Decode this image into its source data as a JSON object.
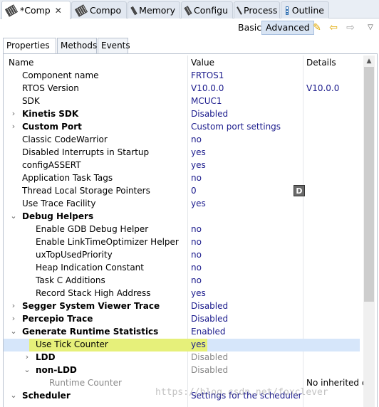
{
  "tabs": [
    {
      "label": "*Comp",
      "icon": "chip-icon",
      "active": true,
      "closable": true
    },
    {
      "label": "Compo",
      "icon": "chip-icon"
    },
    {
      "label": "Memory",
      "icon": "chip-icon"
    },
    {
      "label": "Configu",
      "icon": "chip-icon"
    },
    {
      "label": "Process",
      "icon": "chip-icon"
    },
    {
      "label": "Outline",
      "icon": "outline-icon"
    }
  ],
  "toolbar": {
    "basic_label": "Basic",
    "advanced_label": "Advanced",
    "selected_mode": "Advanced"
  },
  "subtabs": [
    "Properties",
    "Methods",
    "Events"
  ],
  "grid": {
    "headers": {
      "name": "Name",
      "value": "Value",
      "details": "Details"
    },
    "rows": [
      {
        "name": "Component name",
        "value": "FRTOS1",
        "details": ""
      },
      {
        "name": "RTOS Version",
        "value": "V10.0.0",
        "details": "V10.0.0"
      },
      {
        "name": "SDK",
        "value": "MCUC1",
        "details": ""
      },
      {
        "name": "Kinetis SDK",
        "value": "Disabled",
        "details": ""
      },
      {
        "name": "Custom Port",
        "value": "Custom port settings",
        "details": ""
      },
      {
        "name": "Classic CodeWarrior",
        "value": "no",
        "details": ""
      },
      {
        "name": "Disabled Interrupts in Startup",
        "value": "yes",
        "details": ""
      },
      {
        "name": "configASSERT",
        "value": "yes",
        "details": ""
      },
      {
        "name": "Application Task Tags",
        "value": "no",
        "details": ""
      },
      {
        "name": "Thread Local Storage Pointers",
        "value": "0",
        "details": "",
        "button": "D"
      },
      {
        "name": "Use Trace Facility",
        "value": "yes",
        "details": ""
      },
      {
        "name": "Debug Helpers",
        "value": "",
        "details": ""
      },
      {
        "name": "Enable GDB Debug Helper",
        "value": "no",
        "details": ""
      },
      {
        "name": "Enable LinkTimeOptimizer Helper",
        "value": "no",
        "details": ""
      },
      {
        "name": "uxTopUsedPriority",
        "value": "no",
        "details": ""
      },
      {
        "name": "Heap Indication Constant",
        "value": "no",
        "details": ""
      },
      {
        "name": "Task C Additions",
        "value": "no",
        "details": ""
      },
      {
        "name": "Record Stack High Address",
        "value": "yes",
        "details": ""
      },
      {
        "name": "Segger System Viewer Trace",
        "value": "Disabled",
        "details": ""
      },
      {
        "name": "Percepio Trace",
        "value": "Disabled",
        "details": ""
      },
      {
        "name": "Generate Runtime Statistics",
        "value": "Enabled",
        "details": ""
      },
      {
        "name": "Use Tick Counter",
        "value": "yes",
        "details": ""
      },
      {
        "name": "LDD",
        "value": "Disabled",
        "details": ""
      },
      {
        "name": "non-LDD",
        "value": "Disabled",
        "details": ""
      },
      {
        "name": "Runtime Counter",
        "value": "",
        "details": "No inherited c"
      },
      {
        "name": "Scheduler",
        "value": "Settings for the scheduler",
        "details": ""
      }
    ]
  },
  "watermark": "https://blog.csdn.net/foxclever",
  "colors": {
    "value_text": "#1a1a8c",
    "highlight_row": "#d6e6fa",
    "highlight_name": "#e6f07a"
  }
}
